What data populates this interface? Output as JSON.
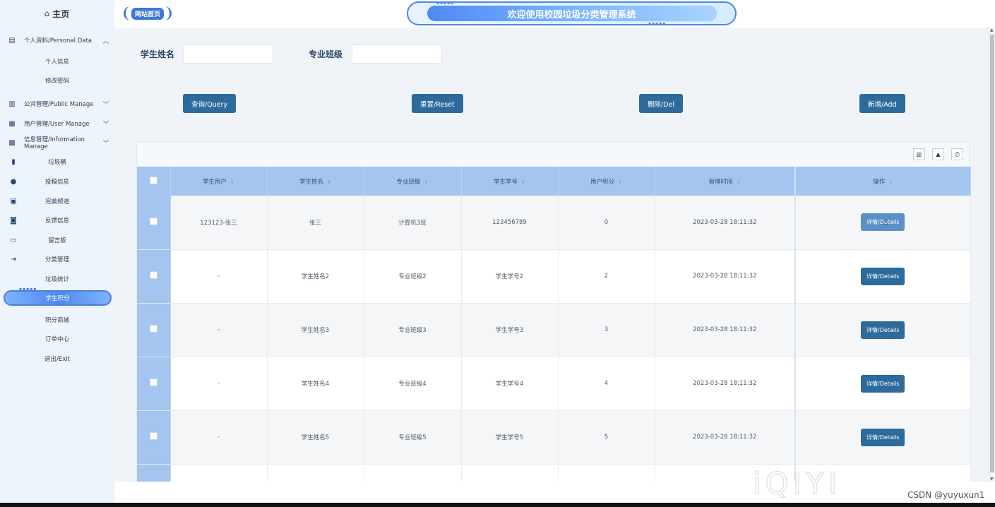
{
  "sidebar": {
    "home": {
      "icon": "home-icon",
      "label": "主页"
    },
    "groups": [
      {
        "label": "个人资料/Personal Data",
        "icon": "document-icon",
        "expanded": true,
        "children": [
          "个人信息",
          "修改密码"
        ]
      },
      {
        "label": "公共管理/Public Manage",
        "icon": "clipboard-icon",
        "expanded": false
      },
      {
        "label": "用户管理/User Manage",
        "icon": "users-icon",
        "expanded": false
      },
      {
        "label": "信息管理/Information Manage",
        "icon": "chart-icon",
        "expanded": true
      }
    ],
    "info_items": [
      {
        "label": "垃圾桶",
        "icon": "bookmark-icon"
      },
      {
        "label": "投稿信息",
        "icon": "person-icon"
      },
      {
        "label": "完美频道",
        "icon": "calendar-icon"
      },
      {
        "label": "反馈信息",
        "icon": "calendar-check-icon"
      },
      {
        "label": "留言板",
        "icon": "book-icon"
      },
      {
        "label": "分类管理",
        "icon": "logout-icon"
      },
      {
        "label": "垃圾统计",
        "icon": ""
      }
    ],
    "active_item": "学生积分",
    "after_items": [
      "积分商城",
      "订单中心",
      "退出/Exit"
    ]
  },
  "header": {
    "home_link": "网站首页",
    "title": "欢迎使用校园垃圾分类管理系统"
  },
  "search": {
    "name_label": "学生姓名",
    "name_value": "",
    "class_label": "专业班级",
    "class_value": ""
  },
  "buttons": {
    "query": "查询/Query",
    "reset": "重置/Reset",
    "delete": "删除/Del",
    "add": "新增/Add"
  },
  "toolbar_icons": [
    "columns-icon",
    "export-icon",
    "print-icon"
  ],
  "table": {
    "columns": [
      "学生用户",
      "学生姓名",
      "专业班级",
      "学生学号",
      "用户积分",
      "新增时间",
      "操作"
    ],
    "rows": [
      {
        "user": "123123-张三",
        "name": "张三",
        "class": "计算机3班",
        "student_no": "123456789",
        "points": "0",
        "time": "2023-03-28 18:11:32",
        "action": "详情/Details"
      },
      {
        "user": "-",
        "name": "学生姓名2",
        "class": "专业班级2",
        "student_no": "学生学号2",
        "points": "2",
        "time": "2023-03-28 18:11:32",
        "action": "详情/Details"
      },
      {
        "user": "-",
        "name": "学生姓名3",
        "class": "专业班级3",
        "student_no": "学生学号3",
        "points": "3",
        "time": "2023-03-28 18:11:32",
        "action": "详情/Details"
      },
      {
        "user": "-",
        "name": "学生姓名4",
        "class": "专业班级4",
        "student_no": "学生学号4",
        "points": "4",
        "time": "2023-03-28 18:11:32",
        "action": "详情/Details"
      },
      {
        "user": "-",
        "name": "学生姓名5",
        "class": "专业班级5",
        "student_no": "学生学号5",
        "points": "5",
        "time": "2023-03-28 18:11:32",
        "action": "详情/Details"
      }
    ]
  },
  "watermark": "iQIYI",
  "credit": "CSDN @yuyuxun1",
  "colors": {
    "primary_button": "#2d6b9d",
    "header_blue": "#a3c5ef",
    "accent": "#4b86ea"
  }
}
